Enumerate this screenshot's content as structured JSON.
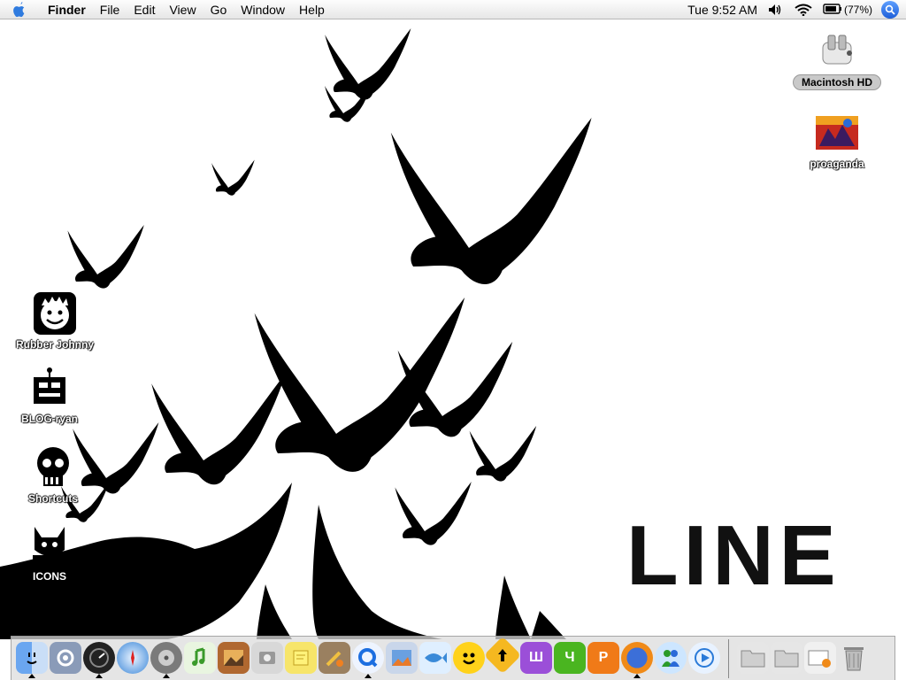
{
  "menubar": {
    "apple_icon": "apple-logo-icon",
    "app_name": "Finder",
    "menus": [
      "File",
      "Edit",
      "View",
      "Go",
      "Window",
      "Help"
    ],
    "clock": "Tue 9:52 AM",
    "battery": "(77%)",
    "status_icons": [
      "volume-icon",
      "wifi-icon",
      "battery-icon",
      "spotlight-icon"
    ]
  },
  "desktop_icons": {
    "macintosh_hd": "Macintosh HD",
    "proaganda": "proaganda",
    "rubber_johnny": "Rubber Johnny",
    "blog_ryan": "BLOG-ryan",
    "shortcuts": "Shortcuts",
    "icons": "ICONS"
  },
  "wallpaper": {
    "text": "LINE"
  },
  "dock": {
    "apps": [
      "finder-icon",
      "system-preferences-icon",
      "dashboard-icon",
      "safari-icon",
      "itunes-icon",
      "garageband-icon",
      "iphoto-icon",
      "imovie-icon",
      "stickies-icon",
      "script-editor-icon",
      "quicktime-icon",
      "preview-icon",
      "fish-icon",
      "smiley-icon",
      "transmit-icon",
      "ichat-icon",
      "firefox-icon",
      "messenger-icon",
      "media-player-icon"
    ],
    "folders": [
      "applications-folder-icon",
      "documents-folder-icon",
      "downloads-icon",
      "trash-icon"
    ]
  },
  "colors": {
    "menubar": "#e9e9e9",
    "wallpaper": "#ffffff",
    "birds": "#000000",
    "spotlight": "#2a6fe0"
  }
}
